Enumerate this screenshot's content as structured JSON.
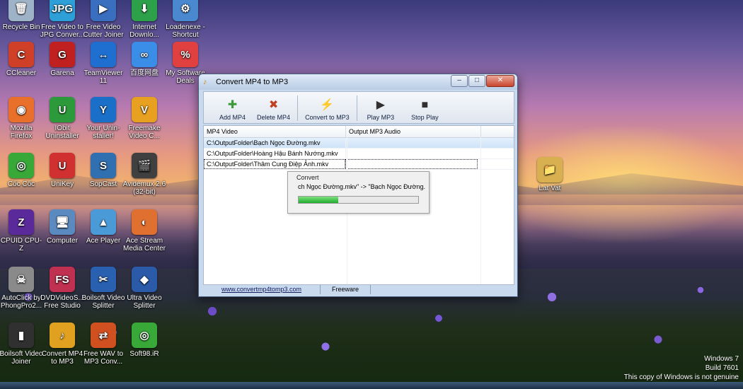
{
  "desktop": {
    "icons": [
      {
        "label": "Recycle Bin",
        "glyph": "🗑",
        "color": "#9fb3c8"
      },
      {
        "label": "Free Video to JPG Conver...",
        "glyph": "JPG",
        "color": "#2f9fd8"
      },
      {
        "label": "Free Video Cutter Joiner",
        "glyph": "▶",
        "color": "#3a6fc0"
      },
      {
        "label": "Internet Downlo...",
        "glyph": "⬇",
        "color": "#2da04a"
      },
      {
        "label": "Loadenexe - Shortcut",
        "glyph": "⚙",
        "color": "#4a88d0"
      },
      {
        "label": "CCleaner",
        "glyph": "C",
        "color": "#d04028"
      },
      {
        "label": "Garena",
        "glyph": "G",
        "color": "#c02020"
      },
      {
        "label": "TeamViewer 11",
        "glyph": "↔",
        "color": "#1e6fd0"
      },
      {
        "label": "百度网盘",
        "glyph": "∞",
        "color": "#3a8ee8"
      },
      {
        "label": "My Software Deals",
        "glyph": "%",
        "color": "#e04040"
      },
      {
        "label": "Mozilla Firefox",
        "glyph": "◉",
        "color": "#e8702a"
      },
      {
        "label": "IObit Uninstaller",
        "glyph": "U",
        "color": "#2c9a3a"
      },
      {
        "label": "Your Unin-staller!",
        "glyph": "Y",
        "color": "#1a70c8"
      },
      {
        "label": "Freemake Video C...",
        "glyph": "V",
        "color": "#e8a020"
      },
      {
        "label": "Cốc Cốc",
        "glyph": "◎",
        "color": "#38a838"
      },
      {
        "label": "UniKey",
        "glyph": "U",
        "color": "#d03030"
      },
      {
        "label": "SopCast",
        "glyph": "S",
        "color": "#3070b0"
      },
      {
        "label": "Avidemux 2.6 (32-bit)",
        "glyph": "🎬",
        "color": "#404040"
      },
      {
        "label": "CPUID CPU-Z",
        "glyph": "Z",
        "color": "#5a2a9a"
      },
      {
        "label": "Computer",
        "glyph": "🖥",
        "color": "#5a8ac0"
      },
      {
        "label": "Ace Player",
        "glyph": "▲",
        "color": "#4a9ad8"
      },
      {
        "label": "Ace Stream Media Center",
        "glyph": "◐",
        "color": "#e07030"
      },
      {
        "label": "AutoClick by PhongPro2...",
        "glyph": "☠",
        "color": "#8a8a8a"
      },
      {
        "label": "DVDVideoS... Free Studio",
        "glyph": "FS",
        "color": "#c03050"
      },
      {
        "label": "Boilsoft Video Splitter",
        "glyph": "✂",
        "color": "#2a60b0"
      },
      {
        "label": "Ultra Video Splitter",
        "glyph": "◆",
        "color": "#2a5aa8"
      },
      {
        "label": "Boilsoft Video Joiner",
        "glyph": "▮",
        "color": "#303030"
      },
      {
        "label": "Convert MP4 to MP3",
        "glyph": "♪",
        "color": "#e0a020"
      },
      {
        "label": "Free WAV to MP3 Conv...",
        "glyph": "⇄",
        "color": "#d05020"
      },
      {
        "label": "Soft98.iR",
        "glyph": "◎",
        "color": "#38a838"
      },
      {
        "label": "Lat Vat",
        "glyph": "📁",
        "color": "#d8b050"
      }
    ],
    "watermark": {
      "line1": "Windows 7",
      "line2": "Build 7601",
      "line3": "This copy of Windows is not genuine"
    }
  },
  "window": {
    "title": "Convert MP4 to MP3",
    "controls": {
      "minimize": "–",
      "maximize": "□",
      "close": "✕"
    },
    "toolbar": [
      {
        "label": "Add MP4",
        "icon": "add-icon",
        "glyph": "✚"
      },
      {
        "label": "Delete MP4",
        "icon": "delete-icon",
        "glyph": "✖"
      },
      {
        "label": "Convert to MP3",
        "icon": "lightning-icon",
        "glyph": "⚡"
      },
      {
        "label": "Play MP3",
        "icon": "play-icon",
        "glyph": "▶"
      },
      {
        "label": "Stop Play",
        "icon": "stop-icon",
        "glyph": "■"
      }
    ],
    "columns": [
      "MP4 Video",
      "Output MP3 Audio"
    ],
    "rows": [
      {
        "video": "C:\\OutputFolder\\Bạch Ngọc Đường.mkv",
        "audio": ""
      },
      {
        "video": "C:\\OutputFolder\\Hoàng Hậu Bánh Nướng.mkv",
        "audio": ""
      },
      {
        "video": "C:\\OutputFolder\\Thâm Cung Điệp Ảnh.mkv",
        "audio": ""
      }
    ],
    "status": {
      "link": "www.convertmp4tomp3.com",
      "license": "Freeware"
    }
  },
  "progress_dialog": {
    "title": "Convert",
    "message": "ch Ngọc Đường.mkv\" -> \"Bạch Ngọc Đường.m",
    "progress": 0.33
  },
  "colors": {
    "progress_fill": "#1fae2e",
    "selection": "#cfe3f8"
  }
}
